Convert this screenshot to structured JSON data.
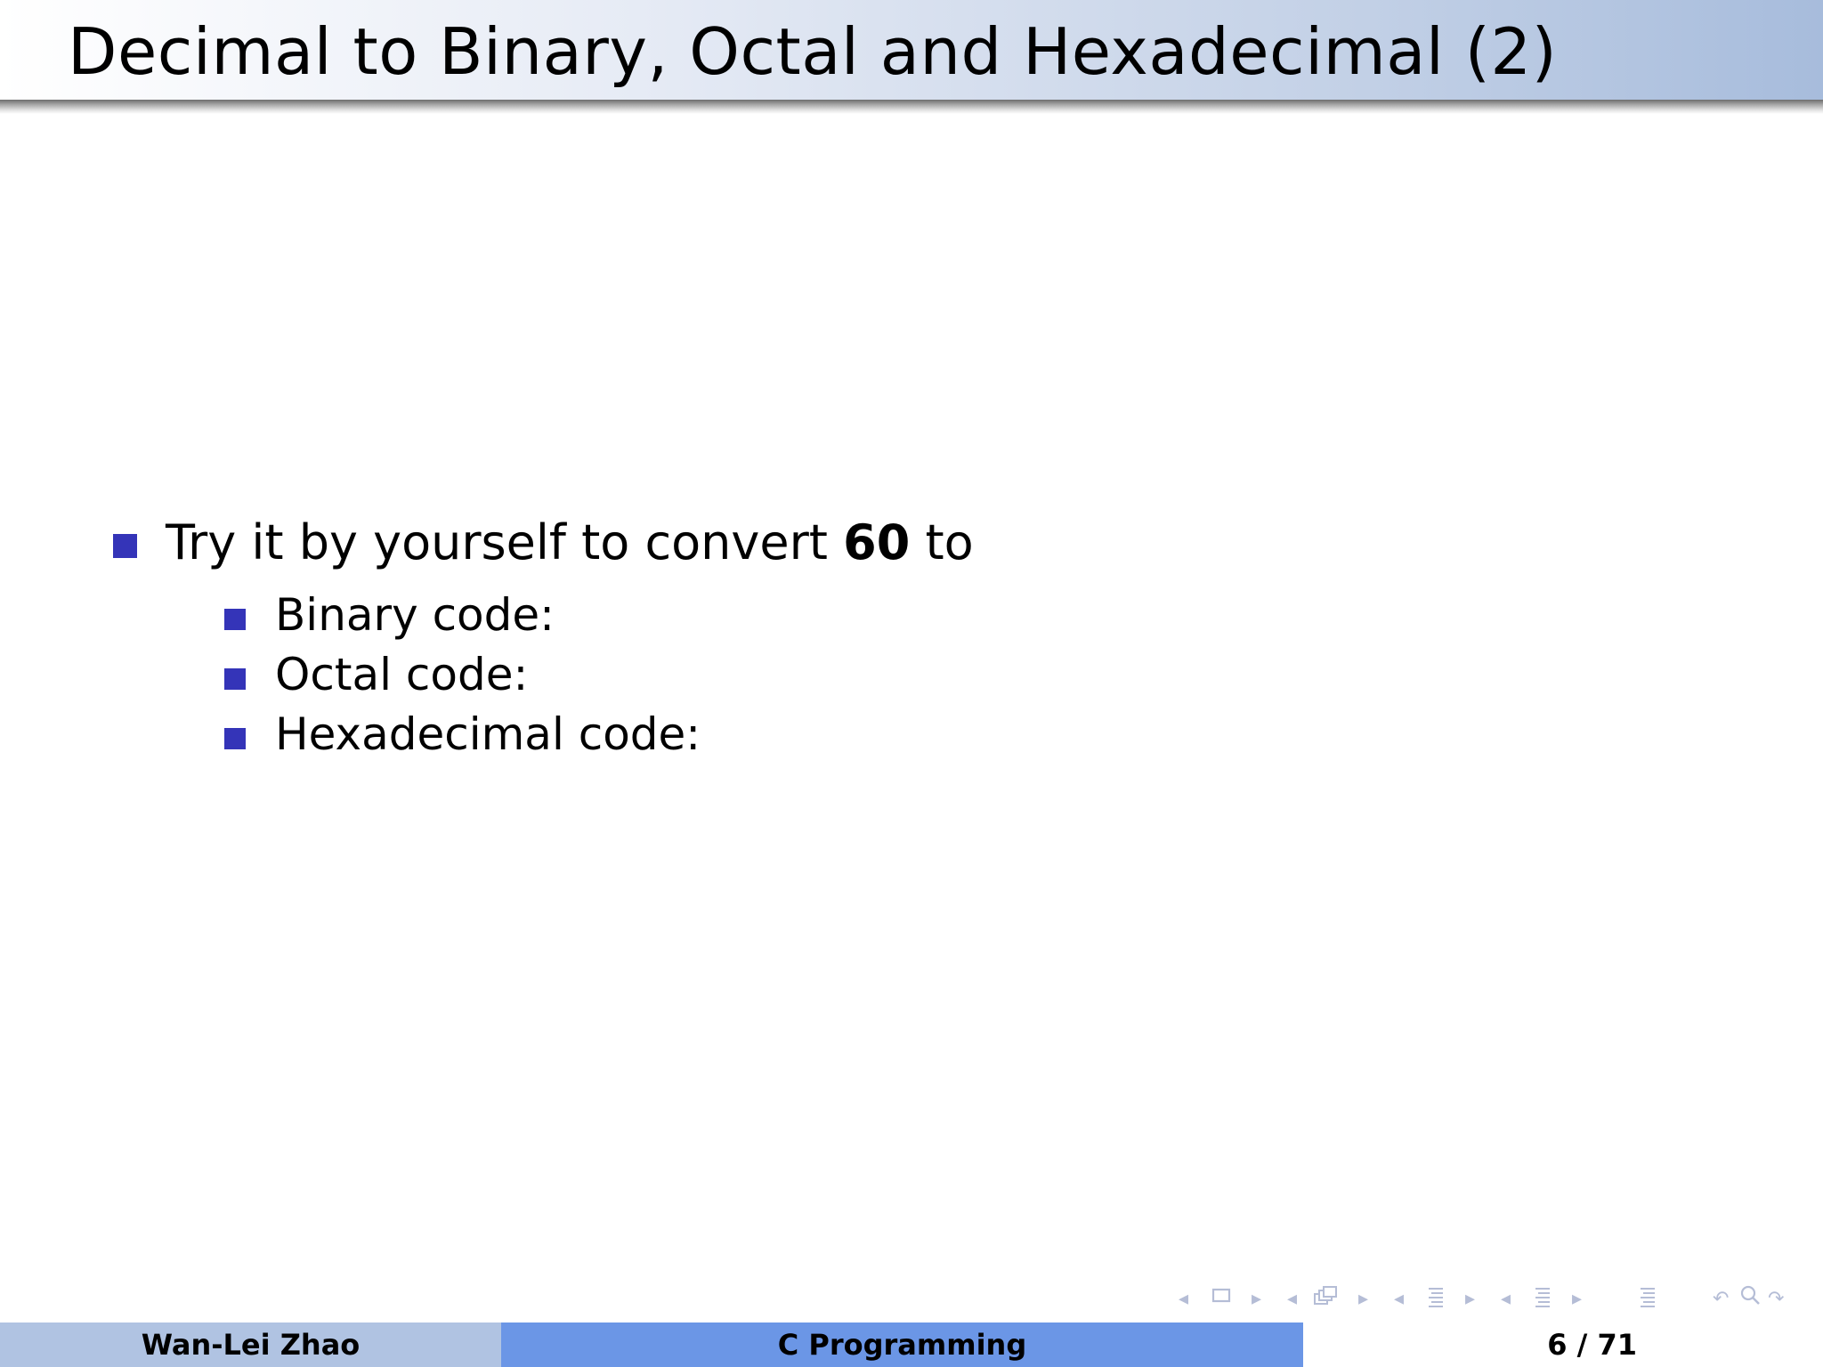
{
  "slide": {
    "title": "Decimal to Binary, Octal and Hexadecimal (2)",
    "main_item": {
      "prefix": "Try it by yourself to convert ",
      "number": "60",
      "suffix": " to"
    },
    "sub_items": [
      "Binary code:",
      "Octal code:",
      "Hexadecimal code:"
    ]
  },
  "footer": {
    "author": "Wan-Lei Zhao",
    "course": "C Programming",
    "page": "6 / 71"
  },
  "colors": {
    "bullet": "#3434b8",
    "footer_left": "#b0c3e2",
    "footer_middle": "#6b96e6",
    "nav_icons": "#b5bdd6"
  },
  "nav_icons": [
    "slide-prev-icon",
    "slide-icon",
    "slide-next-icon",
    "frame-prev-icon",
    "frame-icon",
    "frame-next-icon",
    "subsection-prev-icon",
    "subsection-icon",
    "subsection-next-icon",
    "section-prev-icon",
    "section-icon",
    "section-next-icon",
    "document-icon",
    "undo-icon",
    "search-icon",
    "redo-icon"
  ]
}
